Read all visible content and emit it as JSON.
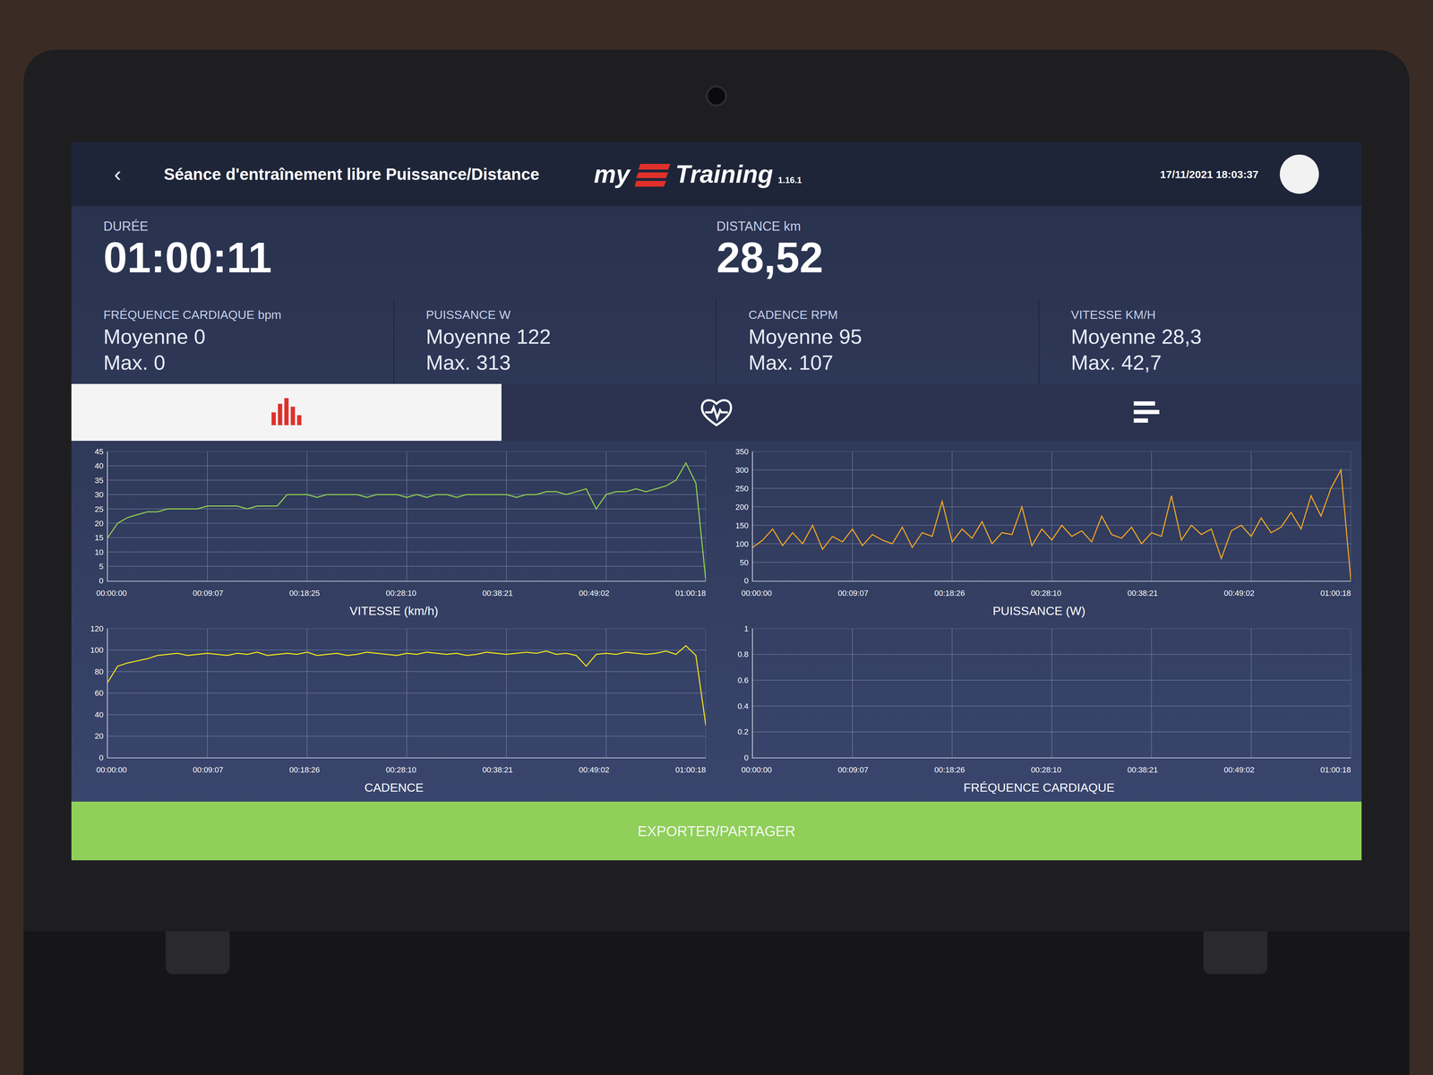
{
  "header": {
    "back": "‹",
    "title": "Séance d'entraînement libre Puissance/Distance",
    "logo": {
      "left": "my",
      "right": "Training",
      "version": "1.16.1"
    },
    "datetime": "17/11/2021 18:03:37"
  },
  "summary": [
    {
      "label": "DURÉE",
      "value": "01:00:11"
    },
    {
      "label": "DISTANCE km",
      "value": "28,52"
    }
  ],
  "stats": [
    {
      "label": "FRÉQUENCE CARDIAQUE bpm",
      "avg_label": "Moyenne",
      "avg": "0",
      "max_label": "Max.",
      "max": "0"
    },
    {
      "label": "PUISSANCE W",
      "avg_label": "Moyenne",
      "avg": "122",
      "max_label": "Max.",
      "max": "313"
    },
    {
      "label": "CADENCE RPM",
      "avg_label": "Moyenne",
      "avg": "95",
      "max_label": "Max.",
      "max": "107"
    },
    {
      "label": "VITESSE KM/H",
      "avg_label": "Moyenne",
      "avg": "28,3",
      "max_label": "Max.",
      "max": "42,7"
    }
  ],
  "tabs": [
    {
      "kind": "histogram",
      "selected": true
    },
    {
      "kind": "heart",
      "selected": false
    },
    {
      "kind": "summary",
      "selected": false
    }
  ],
  "charts": [
    {
      "title": "VITESSE (km/h)",
      "color": "#8fd14f",
      "y_ticks": [
        "45",
        "40",
        "35",
        "30",
        "25",
        "20",
        "15",
        "10",
        "5",
        "0"
      ],
      "x_ticks": [
        "00:00:00",
        "00:09:07",
        "00:18:25",
        "00:28:10",
        "00:38:21",
        "00:49:02",
        "01:00:18"
      ],
      "values": [
        15,
        20,
        22,
        23,
        24,
        24,
        25,
        25,
        25,
        25,
        26,
        26,
        26,
        26,
        25,
        26,
        26,
        26,
        30,
        30,
        30,
        29,
        30,
        30,
        30,
        30,
        29,
        30,
        30,
        30,
        29,
        30,
        29,
        30,
        30,
        29,
        30,
        30,
        30,
        30,
        30,
        29,
        30,
        30,
        31,
        31,
        30,
        31,
        32,
        25,
        30,
        31,
        31,
        32,
        31,
        32,
        33,
        35,
        41,
        34,
        0
      ]
    },
    {
      "title": "PUISSANCE (W)",
      "color": "#f5a623",
      "y_ticks": [
        "350",
        "300",
        "250",
        "200",
        "150",
        "100",
        "50",
        "0"
      ],
      "x_ticks": [
        "00:00:00",
        "00:09:07",
        "00:18:26",
        "00:28:10",
        "00:38:21",
        "00:49:02",
        "01:00:18"
      ],
      "values": [
        90,
        110,
        140,
        95,
        130,
        100,
        150,
        85,
        120,
        105,
        140,
        95,
        125,
        110,
        100,
        145,
        90,
        130,
        120,
        215,
        105,
        140,
        115,
        160,
        100,
        130,
        125,
        200,
        95,
        140,
        110,
        150,
        120,
        135,
        105,
        175,
        125,
        115,
        145,
        100,
        130,
        120,
        230,
        110,
        150,
        125,
        140,
        60,
        135,
        150,
        120,
        170,
        130,
        145,
        185,
        140,
        230,
        175,
        250,
        300,
        0
      ]
    },
    {
      "title": "CADENCE",
      "color": "#f0e020",
      "y_ticks": [
        "120",
        "100",
        "80",
        "60",
        "40",
        "20",
        "0"
      ],
      "x_ticks": [
        "00:00:00",
        "00:09:07",
        "00:18:26",
        "00:28:10",
        "00:38:21",
        "00:49:02",
        "01:00:18"
      ],
      "values": [
        70,
        85,
        88,
        90,
        92,
        95,
        96,
        97,
        95,
        96,
        97,
        96,
        95,
        97,
        96,
        98,
        95,
        96,
        97,
        96,
        98,
        95,
        96,
        97,
        95,
        96,
        98,
        97,
        96,
        95,
        97,
        96,
        98,
        97,
        96,
        97,
        95,
        96,
        98,
        97,
        96,
        97,
        98,
        97,
        99,
        96,
        97,
        95,
        85,
        96,
        97,
        96,
        98,
        97,
        96,
        97,
        99,
        96,
        104,
        95,
        30
      ]
    },
    {
      "title": "FRÉQUENCE CARDIAQUE",
      "color": "#e04040",
      "y_ticks": [
        "1",
        "0.8",
        "0.6",
        "0.4",
        "0.2",
        "0"
      ],
      "x_ticks": [
        "00:00:00",
        "00:09:07",
        "00:18:26",
        "00:28:10",
        "00:38:21",
        "00:49:02",
        "01:00:18"
      ],
      "values": []
    }
  ],
  "export_button": "EXPORTER/PARTAGER"
}
